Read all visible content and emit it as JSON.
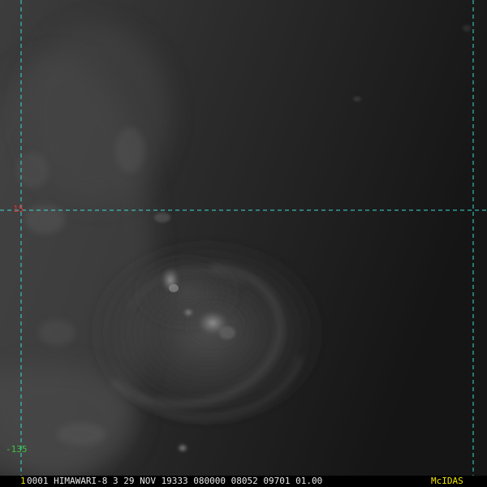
{
  "grid": {
    "line_color": "#3fd6d6",
    "latitude_label": "15",
    "latitude_label_color": "#e0322d",
    "longitude_label": "-135",
    "longitude_label_color": "#3ec43e"
  },
  "status_bar": {
    "frame_number": "1",
    "frame_number_color": "#f2e600",
    "text": "0001 HIMAWARI-8  3 29 NOV 19333 080000 08052 09701 01.00",
    "text_color": "#e8e8e8",
    "logo_text": "McIDAS",
    "logo_color": "#f2e600"
  }
}
